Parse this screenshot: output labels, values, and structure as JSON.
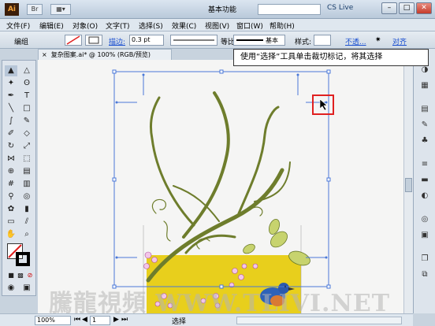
{
  "titlebar": {
    "logo": "Ai",
    "workspace": "基本功能",
    "cslive": "CS Live",
    "minimize": "–",
    "maximize": "□",
    "close": "✕"
  },
  "menu": [
    "文件(F)",
    "编辑(E)",
    "对象(O)",
    "文字(T)",
    "选择(S)",
    "效果(C)",
    "视图(V)",
    "窗口(W)",
    "帮助(H)"
  ],
  "controlbar": {
    "group_label": "编组",
    "stroke_label": "描边:",
    "stroke_value": "0.3 pt",
    "ratio_label": "等比",
    "basic_label": "基本",
    "style_label": "样式:",
    "opacity_label": "不透...",
    "align_label": "对齐"
  },
  "document": {
    "tab_title": "复杂图案.ai* @ 100% (RGB/预览)",
    "tab_close": "×"
  },
  "tooltip": "使用“选择”工具单击裁切标记，将其选择",
  "statusbar": {
    "zoom": "100%",
    "page": "1",
    "tool": "选择"
  },
  "watermark": "騰龍視頻 WWW.TLIVI.NET",
  "colors": {
    "accent_red": "#e02020",
    "selection_blue": "#4a78d8",
    "yellow_rect": "#e8cf1c",
    "vine_green": "#6e7d2c"
  }
}
